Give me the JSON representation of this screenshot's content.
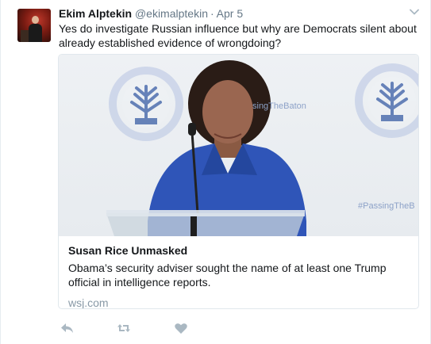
{
  "tweet": {
    "author_name": "Ekim Alptekin",
    "handle": "@ekimalptekin",
    "separator": "·",
    "time": "Apr 5",
    "text": "Yes do investigate Russian influence but why are Democrats silent about already established evidence of wrongdoing?"
  },
  "card": {
    "title": "Susan Rice Unmasked",
    "description": "Obama’s security adviser sought the name of at least one Trump official in intelligence reports.",
    "domain": "wsj.com",
    "photo_backdrop_text_1": "singTheBaton",
    "photo_backdrop_text_2": "#PassingTheB"
  },
  "actions": {
    "reply_icon": "reply-icon",
    "retweet_icon": "retweet-icon",
    "like_icon": "heart-icon"
  },
  "colors": {
    "secondary_text": "#657786",
    "domain_text": "#8899a6",
    "action_icon": "#aab8c2",
    "jacket_blue": "#2f55b8"
  }
}
